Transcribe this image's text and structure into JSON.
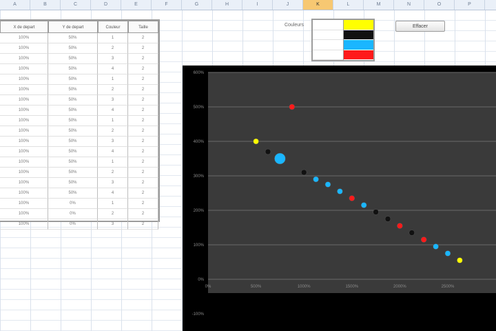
{
  "sheet": {
    "columns": [
      "A",
      "B",
      "C",
      "D",
      "E",
      "F",
      "G",
      "H",
      "I",
      "J",
      "K",
      "L",
      "M",
      "N",
      "O",
      "P"
    ],
    "selected_column": "K"
  },
  "table": {
    "headers": [
      "X de depart",
      "Y de depart",
      "Couleur",
      "Taille"
    ],
    "rows": [
      [
        "100%",
        "50%",
        "1",
        "2"
      ],
      [
        "100%",
        "50%",
        "2",
        "2"
      ],
      [
        "100%",
        "50%",
        "3",
        "2"
      ],
      [
        "100%",
        "50%",
        "4",
        "2"
      ],
      [
        "100%",
        "50%",
        "1",
        "2"
      ],
      [
        "100%",
        "50%",
        "2",
        "2"
      ],
      [
        "100%",
        "50%",
        "3",
        "2"
      ],
      [
        "100%",
        "50%",
        "4",
        "2"
      ],
      [
        "100%",
        "50%",
        "1",
        "2"
      ],
      [
        "100%",
        "50%",
        "2",
        "2"
      ],
      [
        "100%",
        "50%",
        "3",
        "2"
      ],
      [
        "100%",
        "50%",
        "4",
        "2"
      ],
      [
        "100%",
        "50%",
        "1",
        "2"
      ],
      [
        "100%",
        "50%",
        "2",
        "2"
      ],
      [
        "100%",
        "50%",
        "3",
        "2"
      ],
      [
        "100%",
        "50%",
        "4",
        "2"
      ],
      [
        "100%",
        "0%",
        "1",
        "2"
      ],
      [
        "100%",
        "0%",
        "2",
        "2"
      ],
      [
        "100%",
        "0%",
        "3",
        "2"
      ]
    ]
  },
  "legend": {
    "label": "Couleurs",
    "colors": [
      "#ffff00",
      "#111111",
      "#1ab6ff",
      "#ff1a1a"
    ]
  },
  "button": {
    "label": "Effacer"
  },
  "chart_data": {
    "type": "scatter",
    "ylim": [
      -100,
      600
    ],
    "xlim": [
      0,
      2500
    ],
    "y_ticks": [
      "600%",
      "500%",
      "400%",
      "300%",
      "200%",
      "100%",
      "0%",
      "-100%"
    ],
    "x_ticks": [
      "0%",
      "500%",
      "1000%",
      "1500%",
      "2000%",
      "2500%"
    ],
    "grid": true,
    "series_points": [
      {
        "x": 500,
        "y": 400,
        "color": "#ffff00",
        "size": 1
      },
      {
        "x": 625,
        "y": 370,
        "color": "#111111",
        "size": 1
      },
      {
        "x": 750,
        "y": 350,
        "color": "#1ab6ff",
        "size": 2
      },
      {
        "x": 875,
        "y": 500,
        "color": "#ff1a1a",
        "size": 1
      },
      {
        "x": 1000,
        "y": 310,
        "color": "#111111",
        "size": 1
      },
      {
        "x": 1125,
        "y": 290,
        "color": "#1ab6ff",
        "size": 1
      },
      {
        "x": 1250,
        "y": 275,
        "color": "#1ab6ff",
        "size": 1
      },
      {
        "x": 1375,
        "y": 255,
        "color": "#1ab6ff",
        "size": 1
      },
      {
        "x": 1500,
        "y": 235,
        "color": "#ff1a1a",
        "size": 1
      },
      {
        "x": 1625,
        "y": 215,
        "color": "#1ab6ff",
        "size": 1
      },
      {
        "x": 1750,
        "y": 195,
        "color": "#111111",
        "size": 1
      },
      {
        "x": 1875,
        "y": 175,
        "color": "#111111",
        "size": 1
      },
      {
        "x": 2000,
        "y": 155,
        "color": "#ff1a1a",
        "size": 1
      },
      {
        "x": 2125,
        "y": 135,
        "color": "#111111",
        "size": 1
      },
      {
        "x": 2250,
        "y": 115,
        "color": "#ff1a1a",
        "size": 1
      },
      {
        "x": 2375,
        "y": 95,
        "color": "#1ab6ff",
        "size": 1
      },
      {
        "x": 2500,
        "y": 75,
        "color": "#1ab6ff",
        "size": 1
      },
      {
        "x": 2625,
        "y": 55,
        "color": "#ffff00",
        "size": 1
      }
    ]
  }
}
